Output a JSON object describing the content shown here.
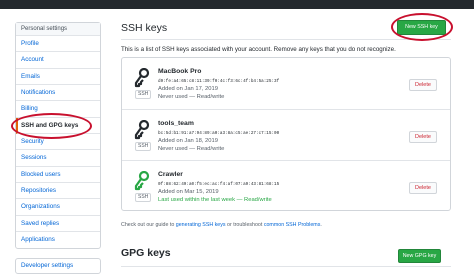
{
  "sidebar": {
    "header": "Personal settings",
    "items": [
      {
        "label": "Profile"
      },
      {
        "label": "Account"
      },
      {
        "label": "Emails"
      },
      {
        "label": "Notifications"
      },
      {
        "label": "Billing"
      },
      {
        "label": "SSH and GPG keys",
        "active": true
      },
      {
        "label": "Security"
      },
      {
        "label": "Sessions"
      },
      {
        "label": "Blocked users"
      },
      {
        "label": "Repositories"
      },
      {
        "label": "Organizations"
      },
      {
        "label": "Saved replies"
      },
      {
        "label": "Applications"
      }
    ],
    "developer_settings": "Developer settings"
  },
  "main": {
    "title": "SSH keys",
    "new_button": "New SSH key",
    "intro": "This is a list of SSH keys associated with your account. Remove any keys that you do not recognize.",
    "keys": [
      {
        "title": "MacBook Pro",
        "fingerprint": "d9:fe:a4:65:c8:11:39:f0:4c:f3:6c:4f:b4:5a:25:3f",
        "added": "Added on Jan 17, 2019",
        "usage": "Never used — Read/write",
        "recent": false,
        "type": "SSH",
        "delete_label": "Delete",
        "icon_color": "#24292e"
      },
      {
        "title": "tools_team",
        "fingerprint": "bc:5d:b1:91:a7:94:89:a0:a3:8a:c5:ae:27:c7:15:00",
        "added": "Added on Jan 18, 2019",
        "usage": "Never used — Read/write",
        "recent": false,
        "type": "SSH",
        "delete_label": "Delete",
        "icon_color": "#24292e"
      },
      {
        "title": "Crawler",
        "fingerprint": "0f:88:62:49:a0:f5:ec:ac:f4:af:07:a9:43:81:68:15",
        "added": "Added on Mar 15, 2019",
        "usage": "Last used within the last week — Read/write",
        "recent": true,
        "type": "SSH",
        "delete_label": "Delete",
        "icon_color": "#28a745"
      }
    ],
    "footer": {
      "prefix": "Check out our guide to ",
      "link1": "generating SSH keys",
      "middle": " or troubleshoot ",
      "link2": "common SSH Problems",
      "suffix": "."
    },
    "gpg_title": "GPG keys",
    "gpg_button": "New GPG key"
  },
  "colors": {
    "accent_green": "#28a745",
    "link_blue": "#0366d6",
    "delete_red": "#cb2431",
    "annotation_red": "#c8102e"
  }
}
